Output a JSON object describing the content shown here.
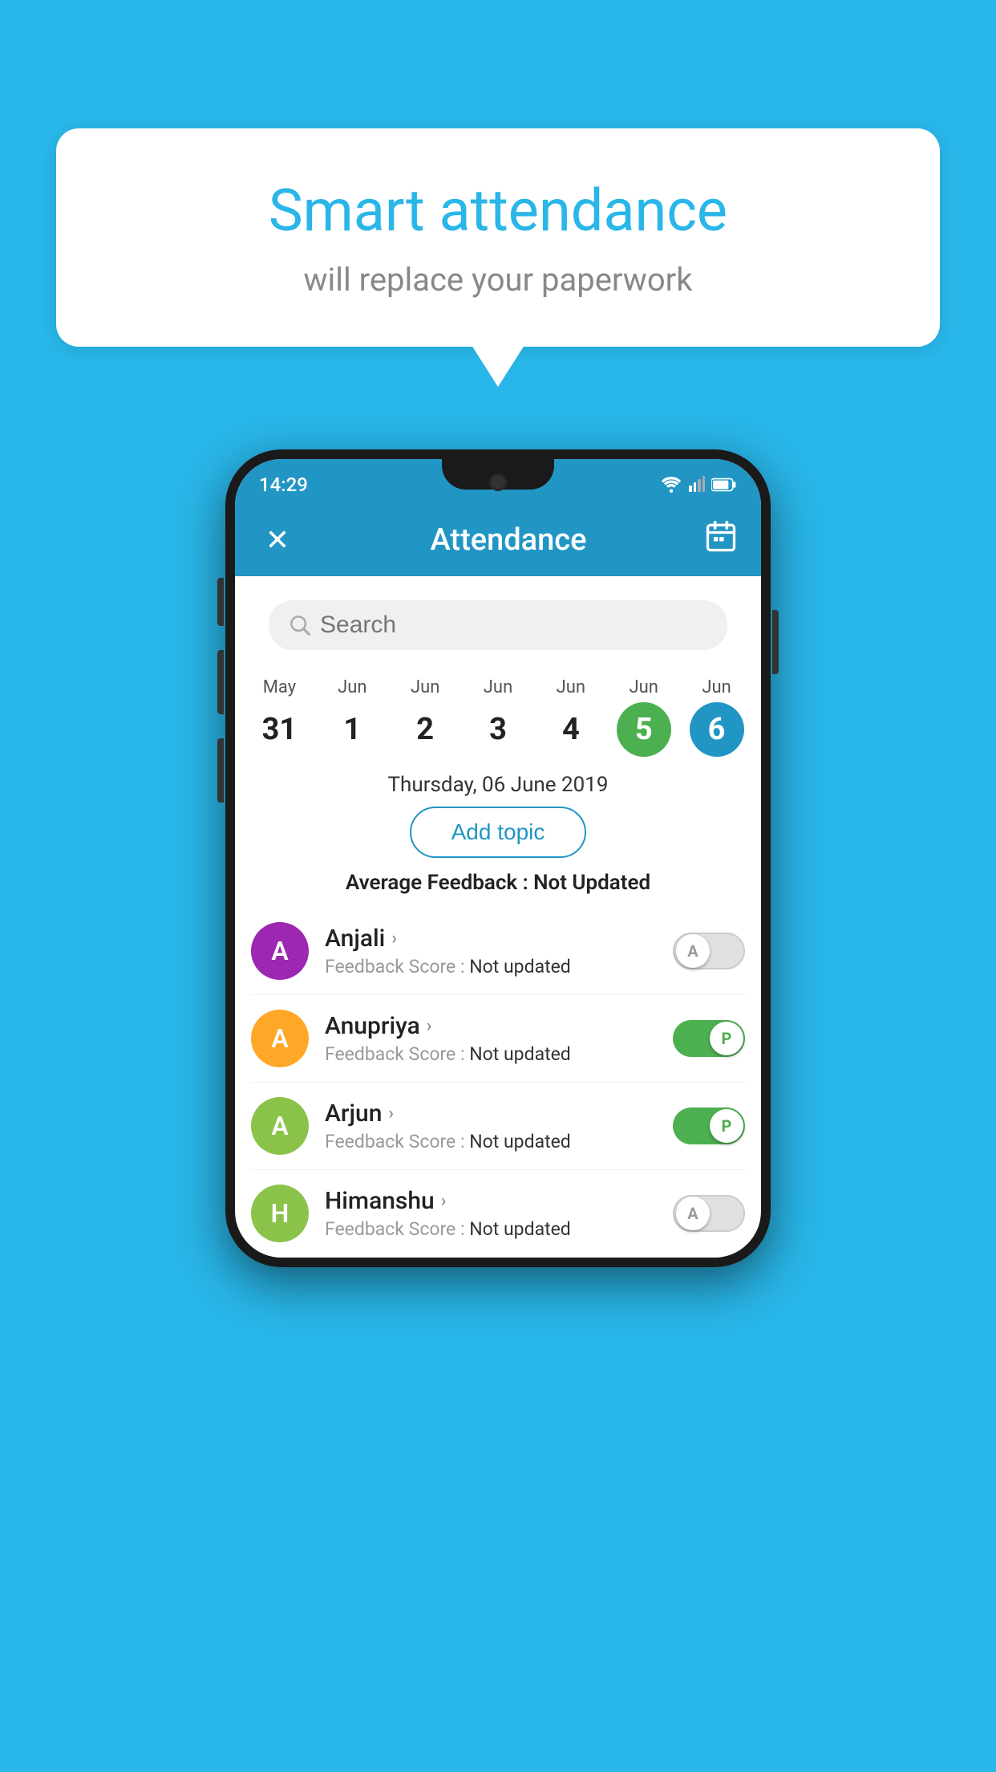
{
  "background_color": "#29b6e8",
  "speech_bubble": {
    "title": "Smart attendance",
    "subtitle": "will replace your paperwork"
  },
  "status_bar": {
    "time": "14:29",
    "wifi": "▼",
    "battery": "🔋"
  },
  "app_bar": {
    "close_label": "✕",
    "title": "Attendance",
    "calendar_icon": "📅"
  },
  "search": {
    "placeholder": "Search"
  },
  "calendar": {
    "days": [
      {
        "month": "May",
        "date": "31",
        "state": "normal"
      },
      {
        "month": "Jun",
        "date": "1",
        "state": "normal"
      },
      {
        "month": "Jun",
        "date": "2",
        "state": "normal"
      },
      {
        "month": "Jun",
        "date": "3",
        "state": "normal"
      },
      {
        "month": "Jun",
        "date": "4",
        "state": "normal"
      },
      {
        "month": "Jun",
        "date": "5",
        "state": "today"
      },
      {
        "month": "Jun",
        "date": "6",
        "state": "selected"
      }
    ]
  },
  "selected_date": "Thursday, 06 June 2019",
  "add_topic_label": "Add topic",
  "avg_feedback_label": "Average Feedback : ",
  "avg_feedback_value": "Not Updated",
  "students": [
    {
      "name": "Anjali",
      "initial": "A",
      "avatar_color": "#9c27b0",
      "feedback_label": "Feedback Score : ",
      "feedback_value": "Not updated",
      "toggle": "off",
      "toggle_letter": "A"
    },
    {
      "name": "Anupriya",
      "initial": "A",
      "avatar_color": "#ffa726",
      "feedback_label": "Feedback Score : ",
      "feedback_value": "Not updated",
      "toggle": "on",
      "toggle_letter": "P"
    },
    {
      "name": "Arjun",
      "initial": "A",
      "avatar_color": "#8bc34a",
      "feedback_label": "Feedback Score : ",
      "feedback_value": "Not updated",
      "toggle": "on",
      "toggle_letter": "P"
    },
    {
      "name": "Himanshu",
      "initial": "H",
      "avatar_color": "#8bc34a",
      "feedback_label": "Feedback Score : ",
      "feedback_value": "Not updated",
      "toggle": "off",
      "toggle_letter": "A"
    }
  ]
}
